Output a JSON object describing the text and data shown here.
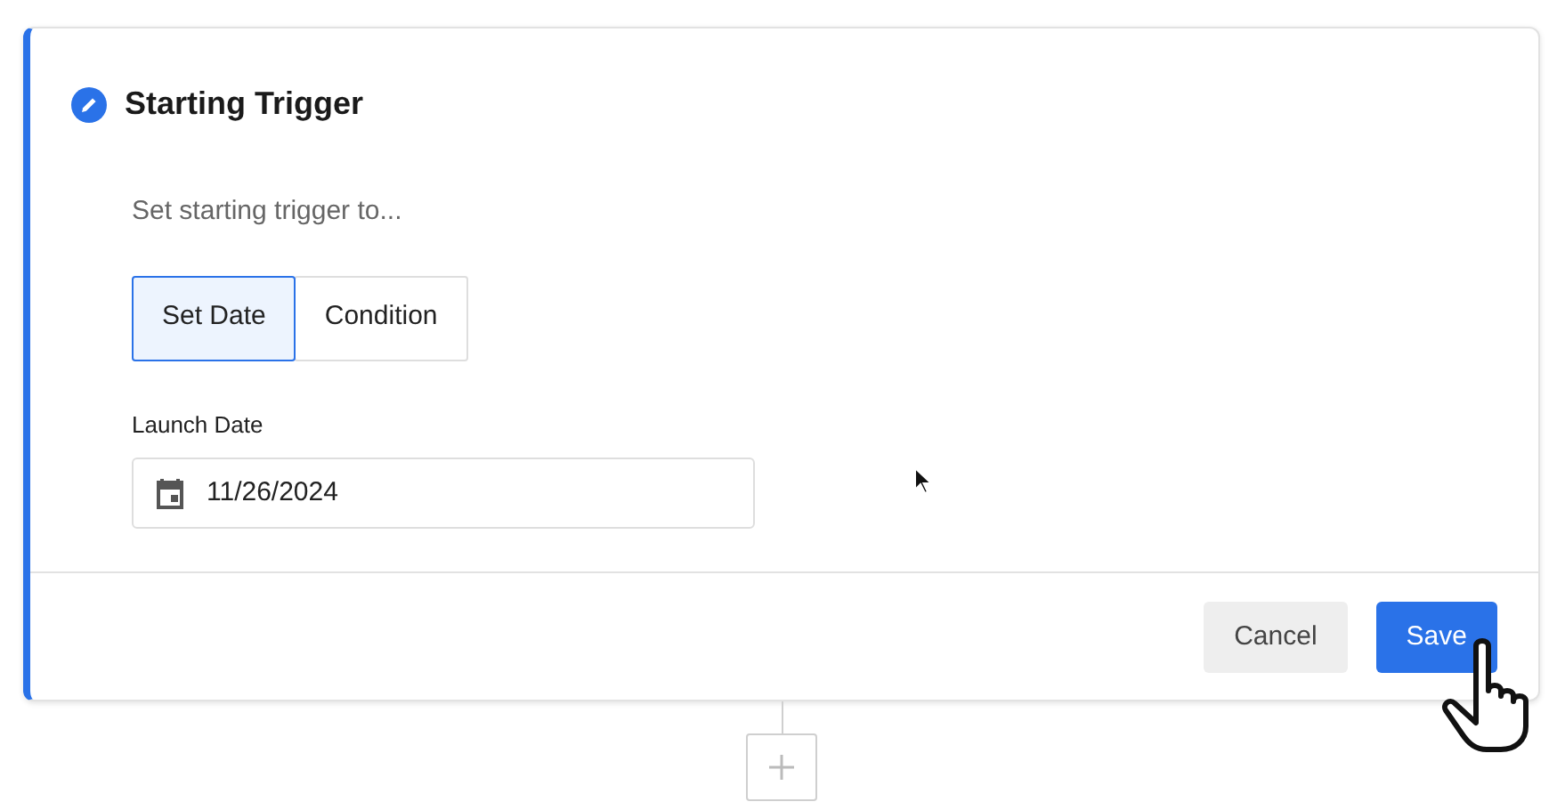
{
  "card": {
    "title": "Starting Trigger",
    "prompt": "Set starting trigger to...",
    "options": [
      {
        "label": "Set Date",
        "selected": true
      },
      {
        "label": "Condition",
        "selected": false
      }
    ],
    "date_field": {
      "label": "Launch Date",
      "value": "11/26/2024"
    },
    "buttons": [
      {
        "label": "Cancel",
        "kind": "secondary"
      },
      {
        "label": "Save",
        "kind": "primary"
      }
    ]
  }
}
